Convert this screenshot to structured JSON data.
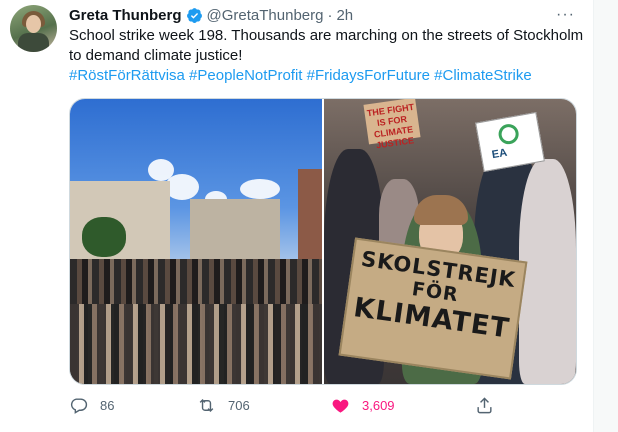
{
  "tweet": {
    "author_name": "Greta Thunberg",
    "handle": "@GretaThunberg",
    "separator": "·",
    "time": "2h",
    "more": "···",
    "text": "School strike week 198. Thousands are marching on the streets of Stockholm to demand climate justice!",
    "hashtags": [
      "#RöstFörRättvisa",
      "#PeopleNotProfit",
      "#FridaysForFuture",
      "#ClimateStrike"
    ],
    "photo_right": {
      "main_sign_lines": [
        "SKOLSTREJK",
        "FÖR",
        "KLIMATET"
      ],
      "top_sign_lines": [
        "THE FIGHT",
        "IS FOR",
        "CLIMATE JUSTICE"
      ],
      "eat_sign_text": "EA"
    }
  },
  "actions": {
    "reply_count": "86",
    "retweet_count": "706",
    "like_count": "3,609"
  },
  "icons": {
    "verified": "verified-badge-icon",
    "more": "more-icon",
    "reply": "reply-icon",
    "retweet": "retweet-icon",
    "like": "heart-icon",
    "share": "share-icon"
  },
  "colors": {
    "accent": "#1d9bf0",
    "like": "#f91880",
    "secondary_text": "#536471"
  }
}
